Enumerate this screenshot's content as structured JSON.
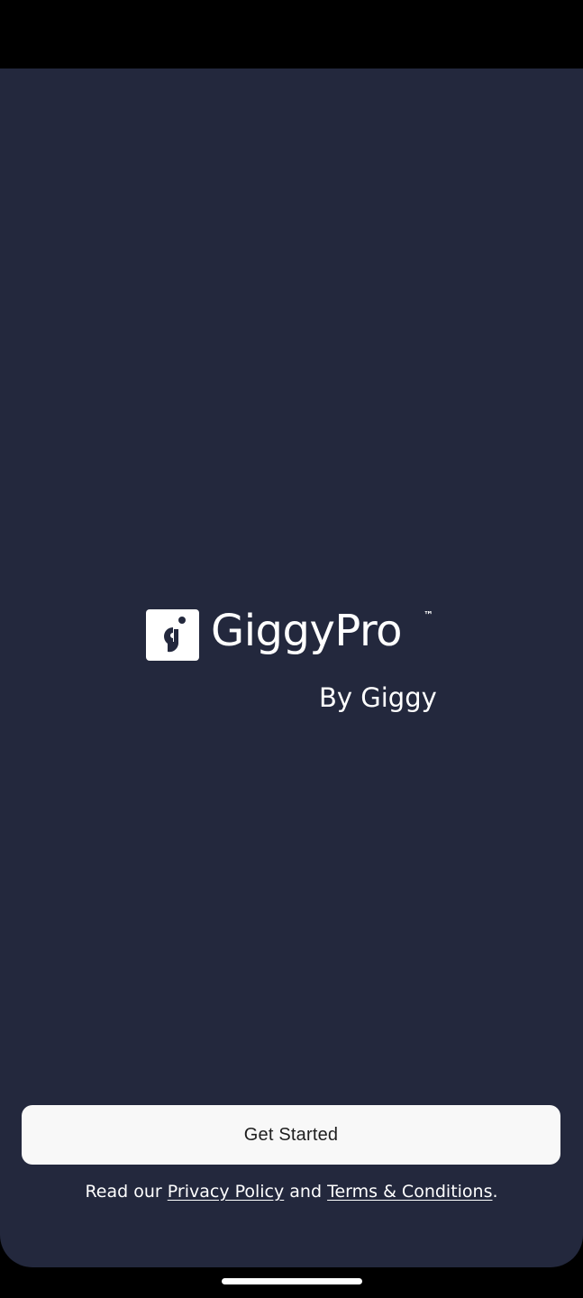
{
  "brand": {
    "name": "GiggyPro",
    "trademark": "™",
    "byline": "By Giggy",
    "logo_icon": "giggy-logo-icon"
  },
  "actions": {
    "get_started_label": "Get Started"
  },
  "legal": {
    "prefix": "Read our ",
    "privacy_label": "Privacy Policy",
    "conjunction": " and ",
    "terms_label": "Terms & Conditions",
    "suffix": "."
  },
  "colors": {
    "background": "#23283d",
    "button_bg": "#f8f8f8",
    "button_text": "#1e1e1e",
    "text": "#ffffff"
  }
}
